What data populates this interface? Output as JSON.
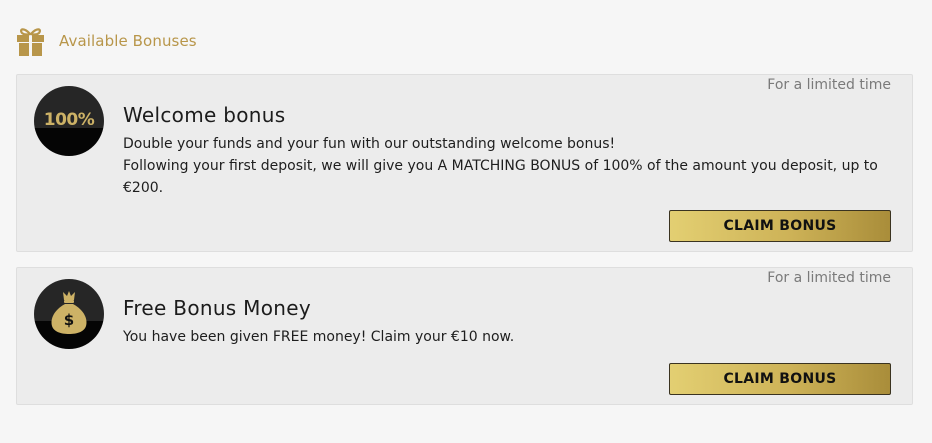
{
  "header": {
    "title": "Available Bonuses",
    "icon": "gift-icon",
    "accent_color": "#b8964a"
  },
  "bonuses": [
    {
      "limited_label": "For a limited time",
      "badge_text": "100%",
      "title": "Welcome bonus",
      "description_lines": [
        "Double your funds and your fun with our outstanding welcome bonus!",
        "Following your first deposit, we will give you A MATCHING BONUS of 100% of the amount you deposit, up to €200."
      ],
      "button_label": "CLAIM BONUS"
    },
    {
      "limited_label": "For a limited time",
      "badge_icon": "money-bag-icon",
      "title": "Free Bonus Money",
      "description_lines": [
        "You have been given FREE money! Claim your €10 now."
      ],
      "button_label": "CLAIM BONUS"
    }
  ]
}
